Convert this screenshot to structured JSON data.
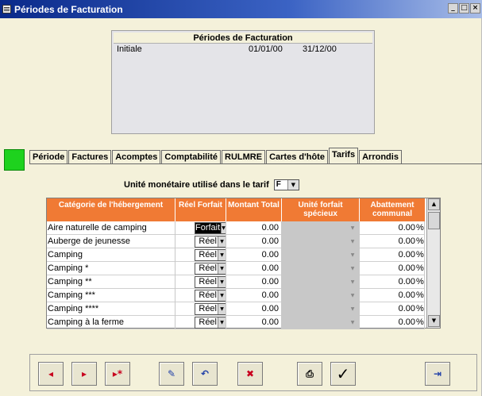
{
  "window": {
    "title": "Périodes de Facturation"
  },
  "title_buttons": {
    "minimize": "_",
    "maximize": "□",
    "close": "×"
  },
  "periods": {
    "header": "Périodes de Facturation",
    "rows": [
      {
        "name": "Initiale",
        "start": "01/01/00",
        "end": "31/12/00"
      }
    ]
  },
  "tabs": [
    {
      "label": "Période",
      "active": false
    },
    {
      "label": "Factures",
      "active": false
    },
    {
      "label": "Acomptes",
      "active": false
    },
    {
      "label": "Comptabilité",
      "active": false
    },
    {
      "label": "RULMRE",
      "active": false
    },
    {
      "label": "Cartes d'hôte",
      "active": false
    },
    {
      "label": "Tarifs",
      "active": true
    },
    {
      "label": "Arrondis",
      "active": false
    }
  ],
  "currency": {
    "label": "Unité monétaire utilisé dans le tarif",
    "value": "F"
  },
  "table": {
    "columns": [
      "Catégorie de l'hébergement",
      "Réel Forfait",
      "Montant Total",
      "Unité forfait spécieux",
      "Abattement communal"
    ],
    "rows": [
      {
        "category": "Aire naturelle de camping",
        "type": "Forfait",
        "amount": "0.00",
        "abatement": "0.00",
        "pct": "%"
      },
      {
        "category": "Auberge de jeunesse",
        "type": "Réel",
        "amount": "0.00",
        "abatement": "0.00",
        "pct": "%"
      },
      {
        "category": "Camping",
        "type": "Réel",
        "amount": "0.00",
        "abatement": "0.00",
        "pct": "%"
      },
      {
        "category": "Camping *",
        "type": "Réel",
        "amount": "0.00",
        "abatement": "0.00",
        "pct": "%"
      },
      {
        "category": "Camping **",
        "type": "Réel",
        "amount": "0.00",
        "abatement": "0.00",
        "pct": "%"
      },
      {
        "category": "Camping ***",
        "type": "Réel",
        "amount": "0.00",
        "abatement": "0.00",
        "pct": "%"
      },
      {
        "category": "Camping ****",
        "type": "Réel",
        "amount": "0.00",
        "abatement": "0.00",
        "pct": "%"
      },
      {
        "category": "Camping à la ferme",
        "type": "Réel",
        "amount": "0.00",
        "abatement": "0.00",
        "pct": "%"
      }
    ]
  },
  "toolbar": {
    "first_glyph": "◂",
    "next_glyph": "▸",
    "new_glyph": "▸*",
    "edit_glyph": "✎",
    "undo_glyph": "↶",
    "delete_glyph": "✖",
    "print_glyph": "⎙",
    "ok_glyph": "✓",
    "exit_glyph": "⇥"
  }
}
